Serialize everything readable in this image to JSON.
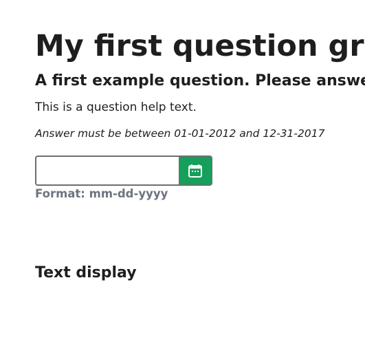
{
  "question_group": {
    "title": "My first question group"
  },
  "question": {
    "text": "A first example question. Please answer this question:",
    "help": "This is a question help text.",
    "tip": "Answer must be between 01-01-2012 and 12-31-2017"
  },
  "date_field": {
    "value": "",
    "placeholder": "",
    "format_hint": "Format: mm-dd-yyyy",
    "button_icon": "calendar-icon",
    "button_color": "#14a05a"
  },
  "text_display": {
    "title": "Text display"
  }
}
